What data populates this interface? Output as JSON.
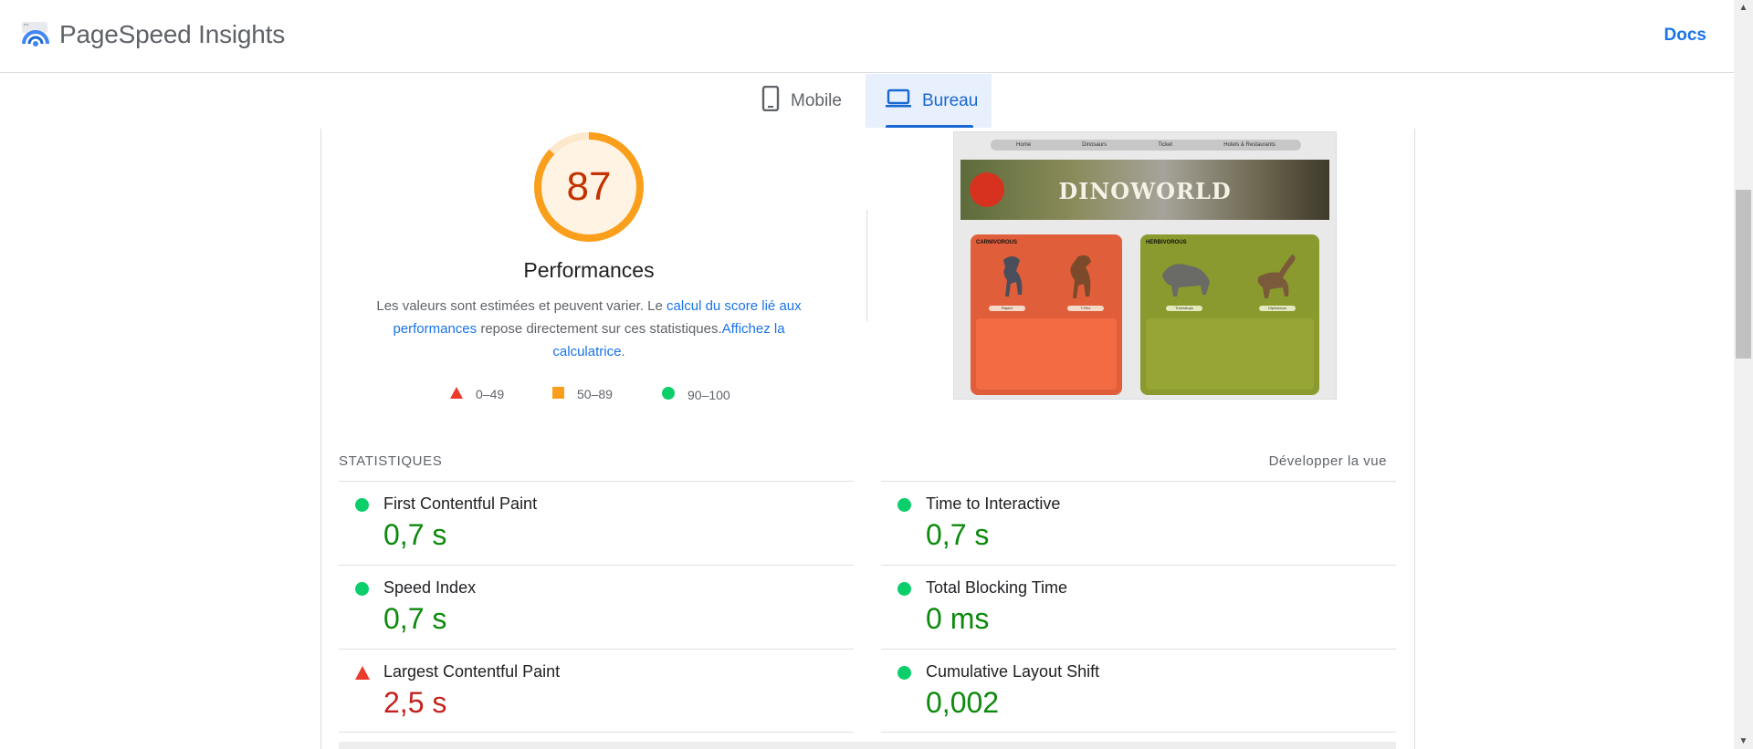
{
  "header": {
    "brand": "PageSpeed Insights",
    "docs_label": "Docs",
    "accent": "#1a73e8"
  },
  "tabs": [
    {
      "label": "Mobile",
      "icon": "smartphone-icon",
      "active": false
    },
    {
      "label": "Bureau",
      "icon": "laptop-icon",
      "active": true
    }
  ],
  "score": {
    "value": "87",
    "title": "Performances",
    "color": "#c33300",
    "ring_color": "#fa9f1b",
    "percent": 87
  },
  "description": {
    "text1": "Les valeurs sont estimées et peuvent varier. Le ",
    "link1": "calcul du score lié aux performances",
    "text2": " repose directement sur ces statistiques.",
    "link2": "Affichez la calculatrice",
    "text3": "."
  },
  "legend": [
    {
      "label": "0–49",
      "shape": "triangle-icon",
      "color": "#eb3a2c"
    },
    {
      "label": "50–89",
      "shape": "square-icon",
      "color": "#fa9f1b"
    },
    {
      "label": "90–100",
      "shape": "circle-icon",
      "color": "#0cce6b"
    }
  ],
  "thumbnail": {
    "nav": [
      "Home",
      "Dinosaurs",
      "Ticket",
      "Hotels & Restaurants"
    ],
    "banner_title": "DINOWORLD",
    "card_left_title": "CARNIVOROUS",
    "card_right_title": "HERBIVOROUS",
    "left_pills": [
      "Raptor",
      "T-Rex"
    ],
    "right_pills": [
      "Triceratops",
      "Diplodocus"
    ]
  },
  "stats": {
    "heading": "STATISTIQUES",
    "expand_label": "Développer la vue",
    "metrics": [
      {
        "name": "First Contentful Paint",
        "value": "0,7 s",
        "status": "good"
      },
      {
        "name": "Time to Interactive",
        "value": "0,7 s",
        "status": "good"
      },
      {
        "name": "Speed Index",
        "value": "0,7 s",
        "status": "good"
      },
      {
        "name": "Total Blocking Time",
        "value": "0 ms",
        "status": "good"
      },
      {
        "name": "Largest Contentful Paint",
        "value": "2,5 s",
        "status": "bad"
      },
      {
        "name": "Cumulative Layout Shift",
        "value": "0,002",
        "status": "good"
      }
    ]
  }
}
